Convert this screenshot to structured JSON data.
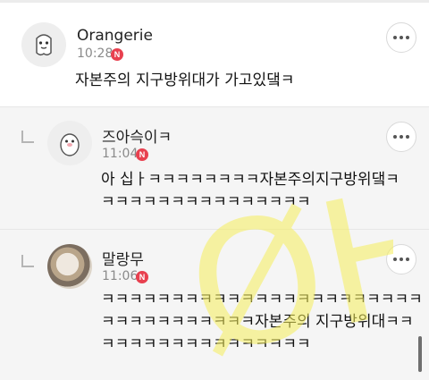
{
  "comments": [
    {
      "author": "Orangerie",
      "time": "10:28",
      "badge": "N",
      "text": "자본주의 지구방위대가 가고있댘ㅋ",
      "avatar_icon": "ghost-character-icon"
    },
    {
      "author": "즈아슥이ㅋ",
      "time": "11:04",
      "badge": "N",
      "text_lines": [
        "아 십ㅏㅋㅋㅋㅋㅋㅋㅋㅋ자본주의지구방위댘ㅋ",
        "ㅋㅋㅋㅋㅋㅋㅋㅋㅋㅋㅋㅋㅋㅋㅋ"
      ],
      "avatar_icon": "penguin-character-icon"
    },
    {
      "author": "말랑무",
      "time": "11:06",
      "badge": "N",
      "text_lines": [
        "ㅋㅋㅋㅋㅋㅋㅋㅋㅋㅋㅋㅋㅋㅋㅋㅋㅋㅋㅋㅋㅋㅋㅋ",
        "ㅋㅋㅋㅋㅋㅋㅋㅋㅋㅋㅋ자본주의 지구방위대ㅋㅋ",
        "ㅋㅋㅋㅋㅋㅋㅋㅋㅋㅋㅋㅋㅋㅋㅋ"
      ],
      "avatar_icon": "cat-photo"
    }
  ],
  "watermark": "ØH",
  "colors": {
    "badge": "#e8404f",
    "reply_bg": "#f5f5f5",
    "watermark": "#f6ef5b"
  }
}
